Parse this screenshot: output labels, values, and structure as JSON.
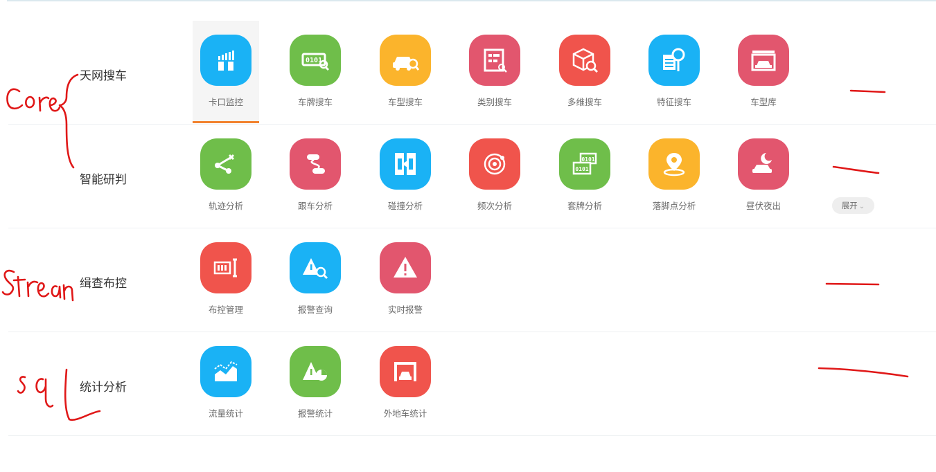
{
  "colors": {
    "blue": "#1ab2f5",
    "green": "#6fbe4a",
    "orange": "#fbb42c",
    "pink": "#e2566e",
    "red": "#f0544c",
    "active_underline": "#f2822e",
    "annotation": "#e01818"
  },
  "sections": [
    {
      "title": "天网搜车",
      "items": [
        {
          "label": "卡口监控",
          "icon": "checkpoint-icon",
          "color": "blue",
          "active": true
        },
        {
          "label": "车牌搜车",
          "icon": "plate-search-icon",
          "color": "green"
        },
        {
          "label": "车型搜车",
          "icon": "car-search-icon",
          "color": "orange"
        },
        {
          "label": "类别搜车",
          "icon": "category-search-icon",
          "color": "pink"
        },
        {
          "label": "多维搜车",
          "icon": "cube-search-icon",
          "color": "red"
        },
        {
          "label": "特征搜车",
          "icon": "feature-search-icon",
          "color": "blue"
        },
        {
          "label": "车型库",
          "icon": "car-library-icon",
          "color": "pink"
        }
      ]
    },
    {
      "title": "智能研判",
      "expand": "展开",
      "items": [
        {
          "label": "轨迹分析",
          "icon": "trajectory-icon",
          "color": "green"
        },
        {
          "label": "跟车分析",
          "icon": "follow-car-icon",
          "color": "pink"
        },
        {
          "label": "碰撞分析",
          "icon": "collision-icon",
          "color": "blue"
        },
        {
          "label": "频次分析",
          "icon": "frequency-icon",
          "color": "red"
        },
        {
          "label": "套牌分析",
          "icon": "cloned-plate-icon",
          "color": "green"
        },
        {
          "label": "落脚点分析",
          "icon": "location-pin-icon",
          "color": "orange"
        },
        {
          "label": "昼伏夜出",
          "icon": "night-car-icon",
          "color": "pink"
        }
      ]
    },
    {
      "title": "缉查布控",
      "items": [
        {
          "label": "布控管理",
          "icon": "deploy-control-icon",
          "color": "red"
        },
        {
          "label": "报警查询",
          "icon": "alarm-search-icon",
          "color": "blue"
        },
        {
          "label": "实时报警",
          "icon": "warning-icon",
          "color": "pink"
        }
      ]
    },
    {
      "title": "统计分析",
      "items": [
        {
          "label": "流量统计",
          "icon": "traffic-chart-icon",
          "color": "blue"
        },
        {
          "label": "报警统计",
          "icon": "alarm-stats-icon",
          "color": "green"
        },
        {
          "label": "外地车统计",
          "icon": "nonlocal-car-icon",
          "color": "red"
        }
      ]
    }
  ],
  "annotations": [
    "Core",
    "Stream",
    "sql"
  ]
}
